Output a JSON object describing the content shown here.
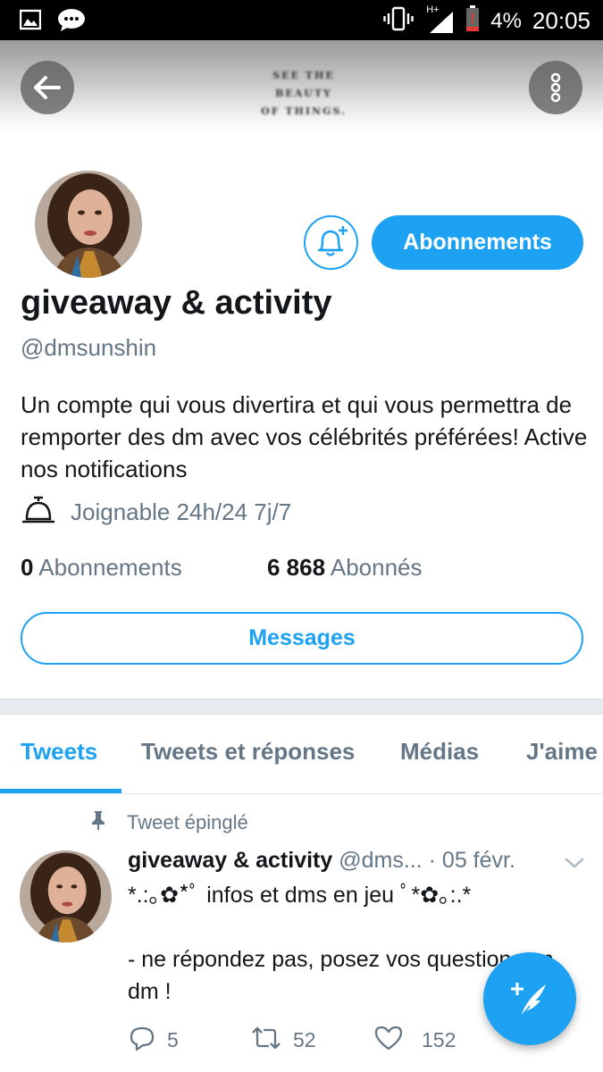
{
  "status_bar": {
    "network": "H+",
    "battery": "4%",
    "time": "20:05"
  },
  "banner": {
    "text": "SEE THE\nBEAUTY\nOF THINGS."
  },
  "profile": {
    "display_name": "giveaway & activity",
    "handle": "@dmsunshin",
    "bio": "Un compte qui vous divertira et qui vous permettra de remporter des dm avec vos célébrités préférées! Active nos notifications",
    "location": "Joignable 24h/24 7j/7",
    "following_count": "0",
    "following_label": "Abonnements",
    "followers_count": "6 868",
    "followers_label": "Abonnés",
    "follow_button": "Abonnements",
    "messages_button": "Messages"
  },
  "tabs": [
    {
      "label": "Tweets",
      "active": true
    },
    {
      "label": "Tweets et réponses",
      "active": false
    },
    {
      "label": "Médias",
      "active": false
    },
    {
      "label": "J'aime",
      "active": false
    }
  ],
  "pinned_tweet": {
    "pinned_label": "Tweet épinglé",
    "author_name": "giveaway & activity",
    "author_handle": "@dms...",
    "date": "· 05 févr.",
    "text": "*.:｡✿*ﾟ infos et dms en jeu ﾟ*✿｡:.*\n\n- ne répondez pas, posez vos questions en dm !",
    "replies": "5",
    "retweets": "52",
    "likes": "152"
  },
  "colors": {
    "accent": "#1da1f2",
    "secondary_text": "#657786",
    "primary_text": "#14171a"
  },
  "icons": [
    "gallery-icon",
    "chat-icon",
    "vibrate-icon",
    "signal-icon",
    "battery-icon",
    "back-arrow-icon",
    "more-vertical-icon",
    "bell-plus-icon",
    "service-bell-icon",
    "pin-icon",
    "chevron-down-icon",
    "reply-icon",
    "retweet-icon",
    "heart-icon",
    "compose-icon"
  ]
}
